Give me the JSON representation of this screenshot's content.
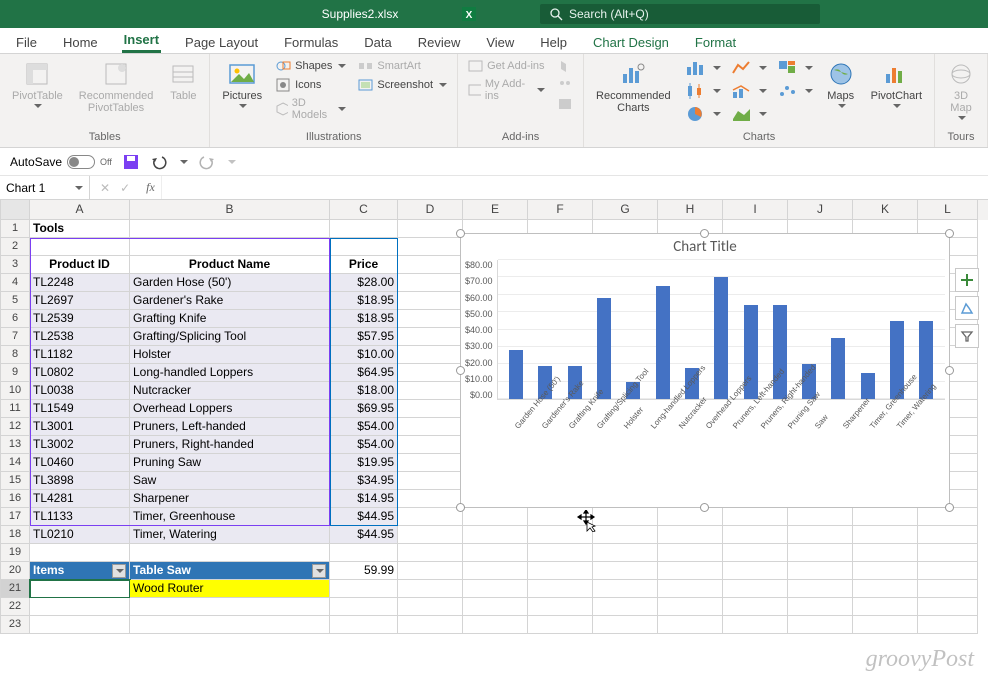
{
  "title": "Supplies2.xlsx",
  "search_placeholder": "Search (Alt+Q)",
  "tabs": [
    "File",
    "Home",
    "Insert",
    "Page Layout",
    "Formulas",
    "Data",
    "Review",
    "View",
    "Help",
    "Chart Design",
    "Format"
  ],
  "active_tab": "Insert",
  "ribbon_groups": {
    "tables": {
      "label": "Tables",
      "items": [
        "PivotTable",
        "Recommended\nPivotTables",
        "Table"
      ]
    },
    "illustrations": {
      "label": "Illustrations",
      "pictures": "Pictures",
      "shapes": "Shapes",
      "icons": "Icons",
      "models": "3D Models",
      "smartart": "SmartArt",
      "screenshot": "Screenshot"
    },
    "addins": {
      "label": "Add-ins",
      "get": "Get Add-ins",
      "my": "My Add-ins"
    },
    "charts": {
      "label": "Charts",
      "recommended": "Recommended\nCharts",
      "maps": "Maps",
      "pivot": "PivotChart"
    },
    "tours": {
      "label": "Tours",
      "map": "3D\nMap"
    }
  },
  "autosave": {
    "label": "AutoSave",
    "state": "Off"
  },
  "namebox": "Chart 1",
  "sheet": {
    "section_title": "Tools",
    "headers": {
      "a": "Product ID",
      "b": "Product Name",
      "c": "Price"
    },
    "rows": [
      {
        "n": 4,
        "a": "TL2248",
        "b": "Garden Hose (50')",
        "c": "$28.00"
      },
      {
        "n": 5,
        "a": "TL2697",
        "b": "Gardener's Rake",
        "c": "$18.95"
      },
      {
        "n": 6,
        "a": "TL2539",
        "b": "Grafting Knife",
        "c": "$18.95"
      },
      {
        "n": 7,
        "a": "TL2538",
        "b": "Grafting/Splicing Tool",
        "c": "$57.95"
      },
      {
        "n": 8,
        "a": "TL1182",
        "b": "Holster",
        "c": "$10.00"
      },
      {
        "n": 9,
        "a": "TL0802",
        "b": "Long-handled Loppers",
        "c": "$64.95"
      },
      {
        "n": 10,
        "a": "TL0038",
        "b": "Nutcracker",
        "c": "$18.00"
      },
      {
        "n": 11,
        "a": "TL1549",
        "b": "Overhead Loppers",
        "c": "$69.95"
      },
      {
        "n": 12,
        "a": "TL3001",
        "b": "Pruners, Left-handed",
        "c": "$54.00"
      },
      {
        "n": 13,
        "a": "TL3002",
        "b": "Pruners, Right-handed",
        "c": "$54.00"
      },
      {
        "n": 14,
        "a": "TL0460",
        "b": "Pruning Saw",
        "c": "$19.95"
      },
      {
        "n": 15,
        "a": "TL3898",
        "b": "Saw",
        "c": "$34.95"
      },
      {
        "n": 16,
        "a": "TL4281",
        "b": "Sharpener",
        "c": "$14.95"
      },
      {
        "n": 17,
        "a": "TL1133",
        "b": "Timer, Greenhouse",
        "c": "$44.95"
      },
      {
        "n": 18,
        "a": "TL0210",
        "b": "Timer, Watering",
        "c": "$44.95"
      }
    ],
    "row20": {
      "a": "Items",
      "b": "Table Saw",
      "c": "59.99"
    },
    "row21": {
      "b": "Wood Router"
    }
  },
  "chart": {
    "title": "Chart Title"
  },
  "chart_data": {
    "type": "bar",
    "title": "Chart Title",
    "xlabel": "",
    "ylabel": "",
    "ylim": [
      0,
      80
    ],
    "yticks": [
      "$0.00",
      "$10.00",
      "$20.00",
      "$30.00",
      "$40.00",
      "$50.00",
      "$60.00",
      "$70.00",
      "$80.00"
    ],
    "categories": [
      "Garden Hose (50')",
      "Gardener's Rake",
      "Grafting Knife",
      "Grafting/Splicing Tool",
      "Holster",
      "Long-handled Loppers",
      "Nutcracker",
      "Overhead Loppers",
      "Pruners, Left-handed",
      "Pruners, Right-handed",
      "Pruning Saw",
      "Saw",
      "Sharpener",
      "Timer, Greenhouse",
      "Timer, Watering"
    ],
    "values": [
      28.0,
      18.95,
      18.95,
      57.95,
      10.0,
      64.95,
      18.0,
      69.95,
      54.0,
      54.0,
      19.95,
      34.95,
      14.95,
      44.95,
      44.95
    ]
  },
  "columns": {
    "A": 100,
    "B": 200,
    "C": 68,
    "D": 65,
    "E": 65,
    "F": 65,
    "G": 65,
    "H": 65,
    "I": 65,
    "J": 65,
    "K": 65,
    "L": 60
  },
  "watermark": "groovyPost"
}
